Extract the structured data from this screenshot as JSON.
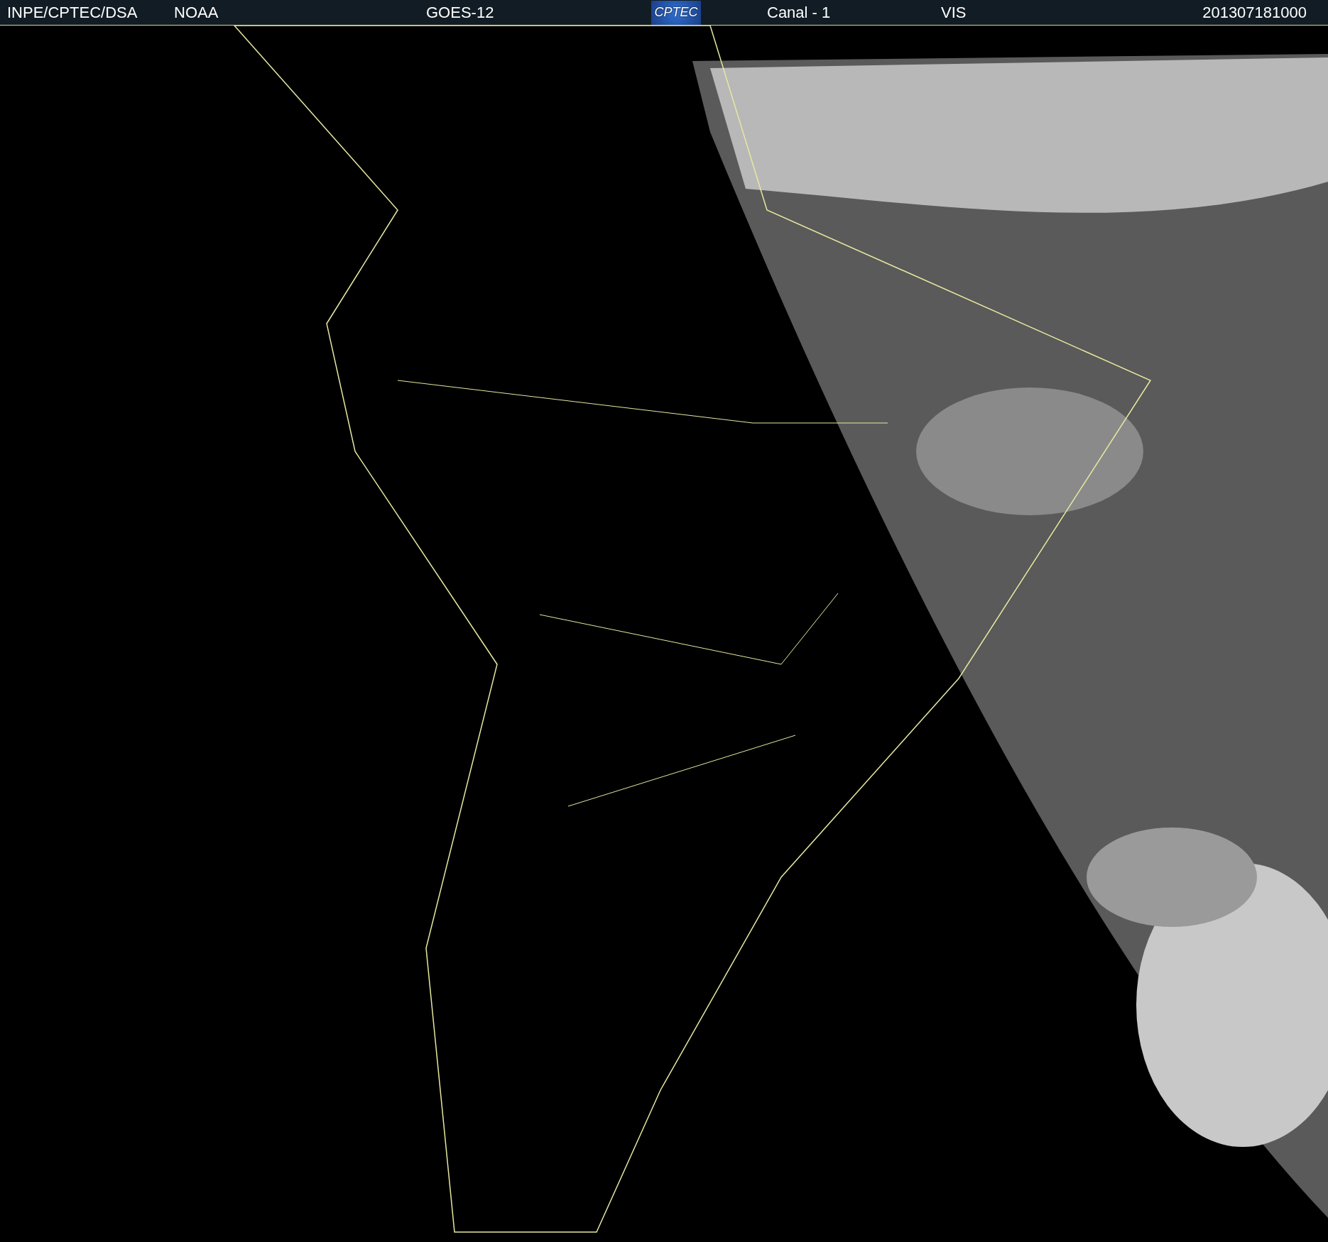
{
  "header": {
    "source": "INPE/CPTEC/DSA",
    "agency": "NOAA",
    "satellite": "GOES-12",
    "logo": "CPTEC",
    "channel": "Canal - 1",
    "band": "VIS",
    "timestamp": "201307181000"
  }
}
